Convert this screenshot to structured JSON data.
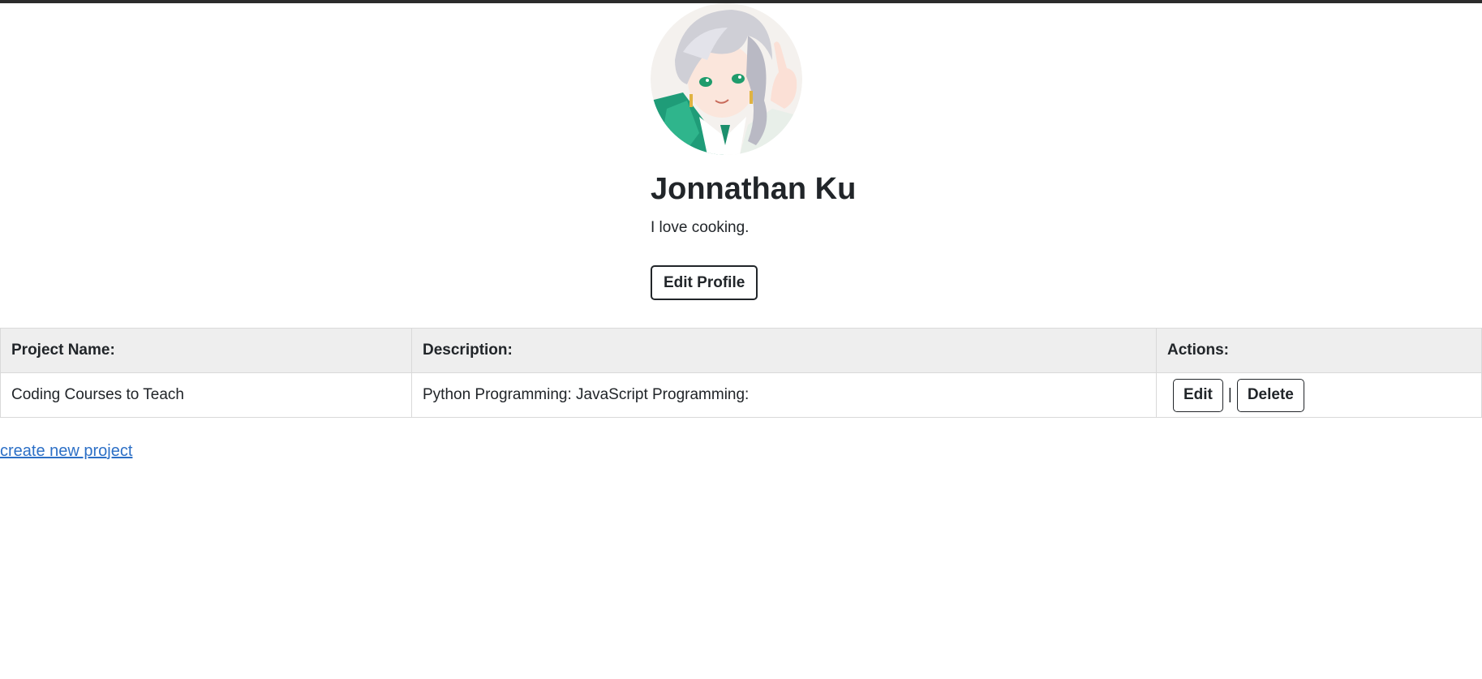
{
  "profile": {
    "name": "Jonnathan Ku",
    "bio": "I love cooking.",
    "edit_label": "Edit Profile"
  },
  "colors": {
    "link": "#2c6fc6",
    "text": "#212529",
    "header_bg": "#eeeeee",
    "avatar_green": "#2fb58c"
  },
  "table": {
    "headers": [
      "Project Name:",
      "Description:",
      "Actions:"
    ],
    "rows": [
      {
        "name": "Coding Courses to Teach",
        "description": "Python Programming: JavaScript Programming:",
        "edit_label": "Edit",
        "separator": "|",
        "delete_label": "Delete"
      }
    ]
  },
  "links": {
    "create_project": "create new project"
  }
}
